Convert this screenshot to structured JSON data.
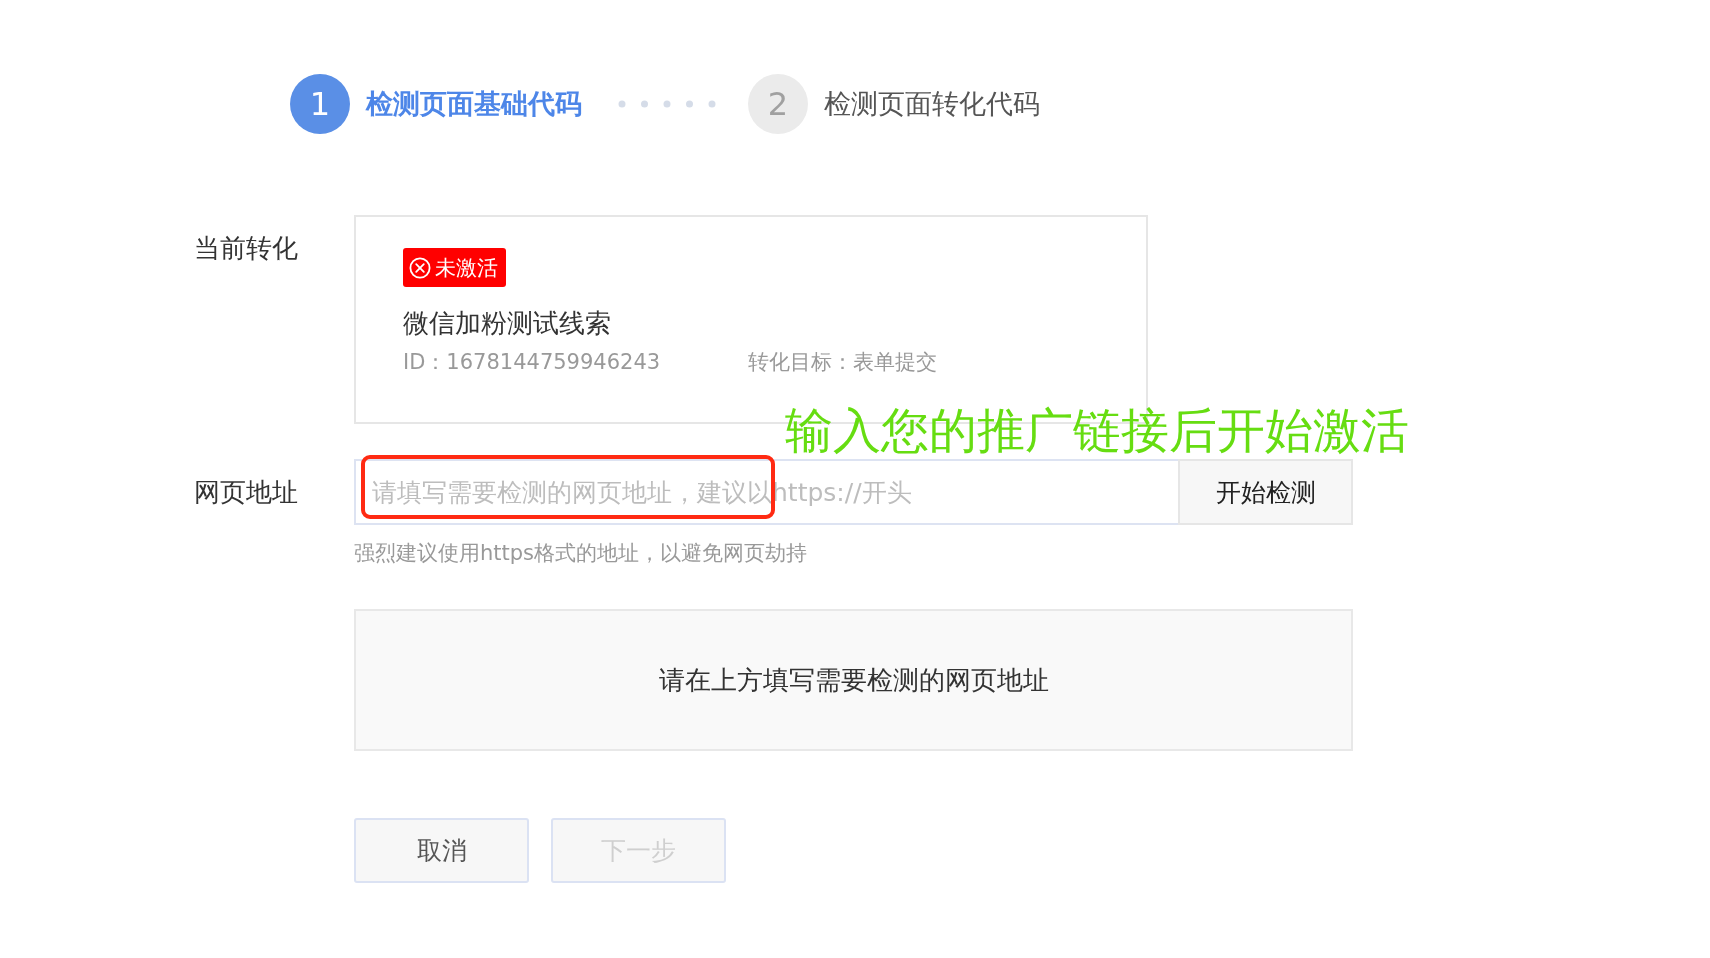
{
  "steps": [
    {
      "number": "1",
      "label": "检测页面基础代码",
      "selected": true
    },
    {
      "number": "2",
      "label": "检测页面转化代码",
      "selected": false
    }
  ],
  "conversion": {
    "label": "当前转化",
    "status": {
      "text": "未激活",
      "active": false
    },
    "name": "微信加粉测试线索",
    "id": "ID：1678144759946243",
    "goal": "转化目标：表单提交"
  },
  "url_field": {
    "label": "网页地址",
    "placeholder": "请填写需要检测的网页地址，建议以https://开头",
    "button": "开始检测",
    "hint": "强烈建议使用https格式的地址，以避免网页劫持"
  },
  "result_panel": {
    "message": "请在上方填写需要检测的网页地址"
  },
  "buttons": [
    {
      "label": "取消",
      "disabled": false
    },
    {
      "label": "下一步",
      "disabled": true
    }
  ],
  "annotation": {
    "text": "输入您的推广链接后开始激活"
  }
}
